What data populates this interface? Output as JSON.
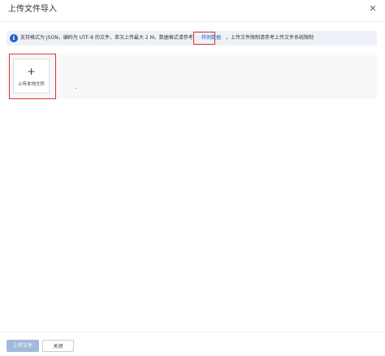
{
  "dialog": {
    "title": "上传文件导入",
    "close_icon": "close-icon"
  },
  "notice": {
    "icon": "info-icon",
    "icon_glyph": "i",
    "text": "支持格式为 JSON，编码为 UTF-8 的文件，单次上传最大 2 M。数据格式请参考",
    "link_text": "样例数据",
    "text_after": "，上传文件限制请参考上传文件系统限制"
  },
  "upload": {
    "plus_glyph": "+",
    "label": "上传本地文件"
  },
  "footer": {
    "upload_button_label": "上传文件",
    "close_button_label": "关闭"
  },
  "colors": {
    "accent": "#1a63c7",
    "highlight": "#e03131",
    "disabled_primary": "#a4b9dc"
  }
}
